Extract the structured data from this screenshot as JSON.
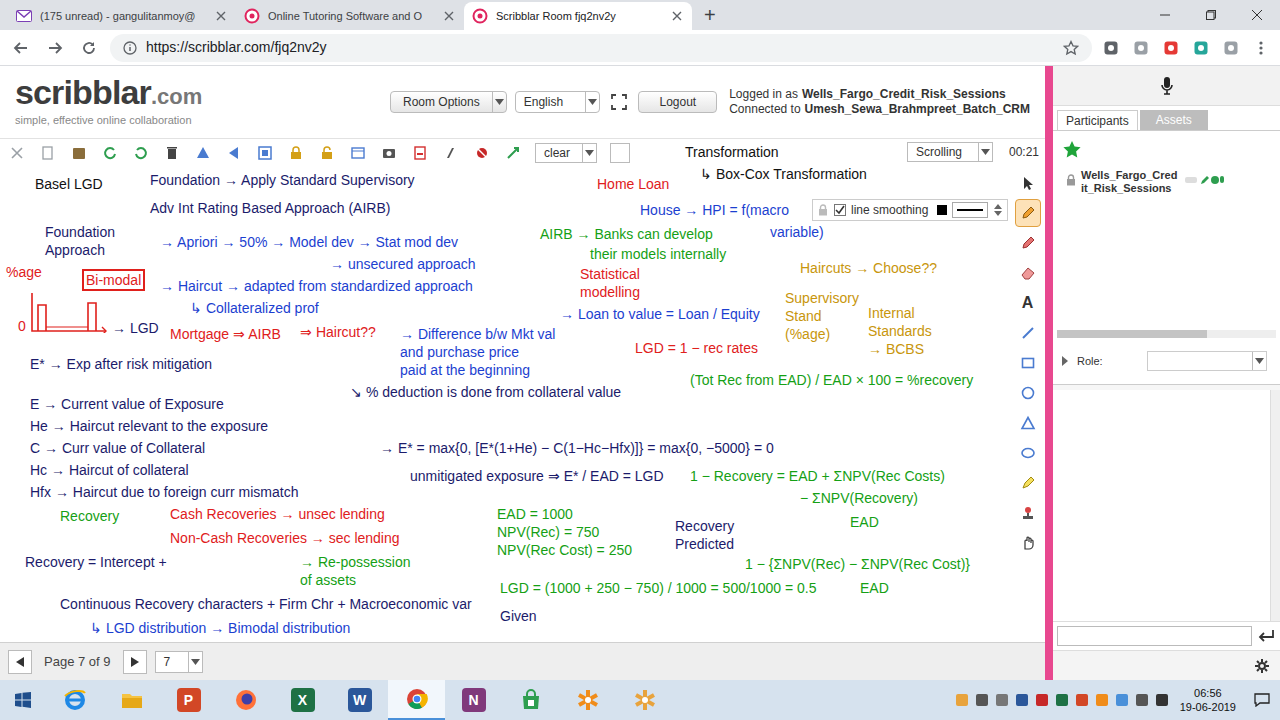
{
  "browser": {
    "tabs": [
      {
        "label": "(175 unread) - gangulitanmoy@",
        "selected": false
      },
      {
        "label": "Online Tutoring Software and O",
        "selected": false
      },
      {
        "label": "Scribblar Room fjq2nv2y",
        "selected": true
      }
    ],
    "new_tab": "+",
    "url": "https://scribblar.com/fjq2nv2y"
  },
  "app": {
    "logo": "scribblar",
    "logo_suffix": ".com",
    "tagline": "simple, effective online collaboration",
    "room_options": "Room Options",
    "language": "English",
    "logout": "Logout",
    "logged_in": "Logged in as",
    "user": "Wells_Fargo_Credit_Risk_Sessions",
    "connected": "Connected to",
    "room": "Umesh_Sewa_Brahmpreet_Batch_CRM"
  },
  "toolbar": {
    "clear": "clear",
    "scroll_mode": "Scrolling",
    "timer": "00:21"
  },
  "line_smoothing": {
    "label": "line smoothing",
    "checked": true
  },
  "tools": [
    {
      "kind": "select",
      "selected": false
    },
    {
      "kind": "pencil",
      "selected": true
    },
    {
      "kind": "pen",
      "selected": false
    },
    {
      "kind": "eraser",
      "selected": false
    },
    {
      "kind": "text",
      "label": "A",
      "selected": false
    },
    {
      "kind": "line",
      "selected": false
    },
    {
      "kind": "rect",
      "selected": false
    },
    {
      "kind": "circle",
      "selected": false
    },
    {
      "kind": "triangle",
      "selected": false
    },
    {
      "kind": "ellipse",
      "selected": false
    },
    {
      "kind": "highlighter",
      "selected": false
    },
    {
      "kind": "stamp",
      "selected": false
    },
    {
      "kind": "hand",
      "selected": false
    }
  ],
  "notes": [
    {
      "text": "Basel LGD",
      "color": "#111111",
      "kind": "text"
    },
    {
      "text": "Foundation → Apply Standard Supervisory",
      "color": "#1b1b6b",
      "kind": "text"
    },
    {
      "text": "Adv Int Rating Based Approach (AIRB)",
      "color": "#1b1b6b",
      "kind": "text"
    },
    {
      "text": "Foundation\nApproach",
      "color": "#1b1b6b",
      "kind": "text"
    },
    {
      "text": "→ Apriori → 50% → Model dev → Stat mod dev",
      "color": "#1c3fd0",
      "kind": "text"
    },
    {
      "text": "→ unsecured approach",
      "color": "#1c3fd0",
      "kind": "text"
    },
    {
      "text": "%age",
      "color": "#e0201c",
      "kind": "text"
    },
    {
      "text": "Bi-modal",
      "color": "#e0201c",
      "kind": "boxed"
    },
    {
      "text": "0",
      "color": "#e0201c",
      "kind": "text"
    },
    {
      "text": "→ LGD",
      "color": "#1b1b6b",
      "kind": "text"
    },
    {
      "text": "→ Haircut → adapted from standardized approach",
      "color": "#1c3fd0",
      "kind": "text"
    },
    {
      "text": "↳ Collateralized prof",
      "color": "#1c3fd0",
      "kind": "text"
    },
    {
      "text": "Mortgage ⇒ AIRB",
      "color": "#e0201c",
      "kind": "text"
    },
    {
      "text": "⇒ Haircut??",
      "color": "#e0201c",
      "kind": "text"
    },
    {
      "text": "→ Difference b/w Mkt val\nand purchase price\npaid at the beginning",
      "color": "#1c3fd0",
      "kind": "text"
    },
    {
      "text": "→ Loan to value = Loan / Equity",
      "color": "#1c3fd0",
      "kind": "text"
    },
    {
      "text": "↘ % deduction is done from collateral value",
      "color": "#1b1b6b",
      "kind": "text"
    },
    {
      "text": "E* → Exp after risk mitigation",
      "color": "#1b1b6b",
      "kind": "text"
    },
    {
      "text": "E → Current value of Exposure",
      "color": "#1b1b6b",
      "kind": "text"
    },
    {
      "text": "He → Haircut relevant to the exposure",
      "color": "#1b1b6b",
      "kind": "text"
    },
    {
      "text": "C → Curr value of Collateral",
      "color": "#1b1b6b",
      "kind": "text"
    },
    {
      "text": "Hc → Haircut of collateral",
      "color": "#1b1b6b",
      "kind": "text"
    },
    {
      "text": "Hfx → Haircut due to foreign curr mismatch",
      "color": "#1b1b6b",
      "kind": "text"
    },
    {
      "text": "→ E* = max{0, [E*(1+He) − C(1−Hc−Hfx)]} = max{0, −5000} = 0",
      "color": "#1b1b6b",
      "kind": "text"
    },
    {
      "text": "unmitigated exposure ⇒ E* / EAD = LGD",
      "color": "#1b1b6b",
      "kind": "text"
    },
    {
      "text": "Recovery",
      "color": "#15a015",
      "kind": "text"
    },
    {
      "text": "Cash Recoveries → unsec lending",
      "color": "#e0201c",
      "kind": "text"
    },
    {
      "text": "Non-Cash Recoveries → sec lending",
      "color": "#e0201c",
      "kind": "text"
    },
    {
      "text": "→ Re-possession\nof assets",
      "color": "#15a015",
      "kind": "text"
    },
    {
      "text": "Recovery = Intercept +",
      "color": "#1b1b6b",
      "kind": "text"
    },
    {
      "text": "Continuous Recovery characters + Firm Chr + Macroeconomic var",
      "color": "#1b1b6b",
      "kind": "text"
    },
    {
      "text": "↳ LGD distribution → Bimodal distribution",
      "color": "#1c3fd0",
      "kind": "text"
    },
    {
      "text": "EAD = 1000\nNPV(Rec) = 750\nNPV(Rec Cost) = 250",
      "color": "#15a015",
      "kind": "text"
    },
    {
      "text": "LGD = (1000 + 250 − 750) / 1000 = 500/1000 = 0.5",
      "color": "#15a015",
      "kind": "text"
    },
    {
      "text": "Given",
      "color": "#1b1b6b",
      "kind": "text"
    },
    {
      "text": "Recovery\nPredicted",
      "color": "#1b1b6b",
      "kind": "text"
    },
    {
      "text": "Transformation",
      "color": "#111111",
      "kind": "text"
    },
    {
      "text": "↳ Box-Cox Transformation",
      "color": "#111111",
      "kind": "text"
    },
    {
      "text": "Home Loan",
      "color": "#e0201c",
      "kind": "text"
    },
    {
      "text": "House → HPI = f(macro",
      "color": "#1c3fd0",
      "kind": "text"
    },
    {
      "text": "variable)",
      "color": "#1c3fd0",
      "kind": "text"
    },
    {
      "text": "AIRB → Banks can develop",
      "color": "#15a015",
      "kind": "text"
    },
    {
      "text": "their models internally",
      "color": "#15a015",
      "kind": "text"
    },
    {
      "text": "Statistical\nmodelling",
      "color": "#e0201c",
      "kind": "text"
    },
    {
      "text": "Haircuts → Choose??",
      "color": "#c8960c",
      "kind": "text"
    },
    {
      "text": "Supervisory\nStand\n(%age)",
      "color": "#c8960c",
      "kind": "text"
    },
    {
      "text": "Internal\nStandards\n→ BCBS",
      "color": "#c8960c",
      "kind": "text"
    },
    {
      "text": "LGD = 1 − rec rates",
      "color": "#e0201c",
      "kind": "text"
    },
    {
      "text": "(Tot Rec from EAD) / EAD × 100 = %recovery",
      "color": "#15a015",
      "kind": "text"
    },
    {
      "text": "1 − Recovery = EAD + ΣNPV(Rec Costs)",
      "color": "#15a015",
      "kind": "text"
    },
    {
      "text": "− ΣNPV(Recovery)",
      "color": "#15a015",
      "kind": "text"
    },
    {
      "text": "EAD",
      "color": "#15a015",
      "kind": "text"
    },
    {
      "text": "1 − {ΣNPV(Rec) − ΣNPV(Rec Cost)}",
      "color": "#15a015",
      "kind": "text"
    },
    {
      "text": "EAD",
      "color": "#15a015",
      "kind": "text"
    }
  ],
  "pager": {
    "label": "Page 7 of 9",
    "page": "7"
  },
  "panel": {
    "tabs": [
      {
        "label": "Participants",
        "selected": true
      },
      {
        "label": "Assets",
        "selected": false
      }
    ],
    "participants": [
      {
        "name": "Wells_Fargo_Credit_Risk_Sessions"
      }
    ],
    "role_label": "Role:"
  },
  "taskbar": {
    "apps": [
      {
        "kind": "ie",
        "color": "#1e88e5",
        "selected": false
      },
      {
        "kind": "explorer",
        "color": "#f5c342",
        "selected": false
      },
      {
        "kind": "letter",
        "glyph": "P",
        "color": "#d24726",
        "selected": false
      },
      {
        "kind": "firefox",
        "color": "#ff7139",
        "selected": false
      },
      {
        "kind": "letter",
        "glyph": "X",
        "color": "#1e7145",
        "selected": false
      },
      {
        "kind": "letter",
        "glyph": "W",
        "color": "#2b579a",
        "selected": false
      },
      {
        "kind": "chrome",
        "color": "#db4437",
        "selected": true
      },
      {
        "kind": "letter",
        "glyph": "N",
        "color": "#80397b",
        "selected": false
      },
      {
        "kind": "store",
        "color": "#2e9e4f",
        "selected": false
      },
      {
        "kind": "asterisk",
        "color": "#f08c1a",
        "selected": false
      },
      {
        "kind": "asterisk",
        "color": "#e8a33c",
        "selected": false
      }
    ],
    "time": "06:56",
    "date": "19-06-2019"
  }
}
